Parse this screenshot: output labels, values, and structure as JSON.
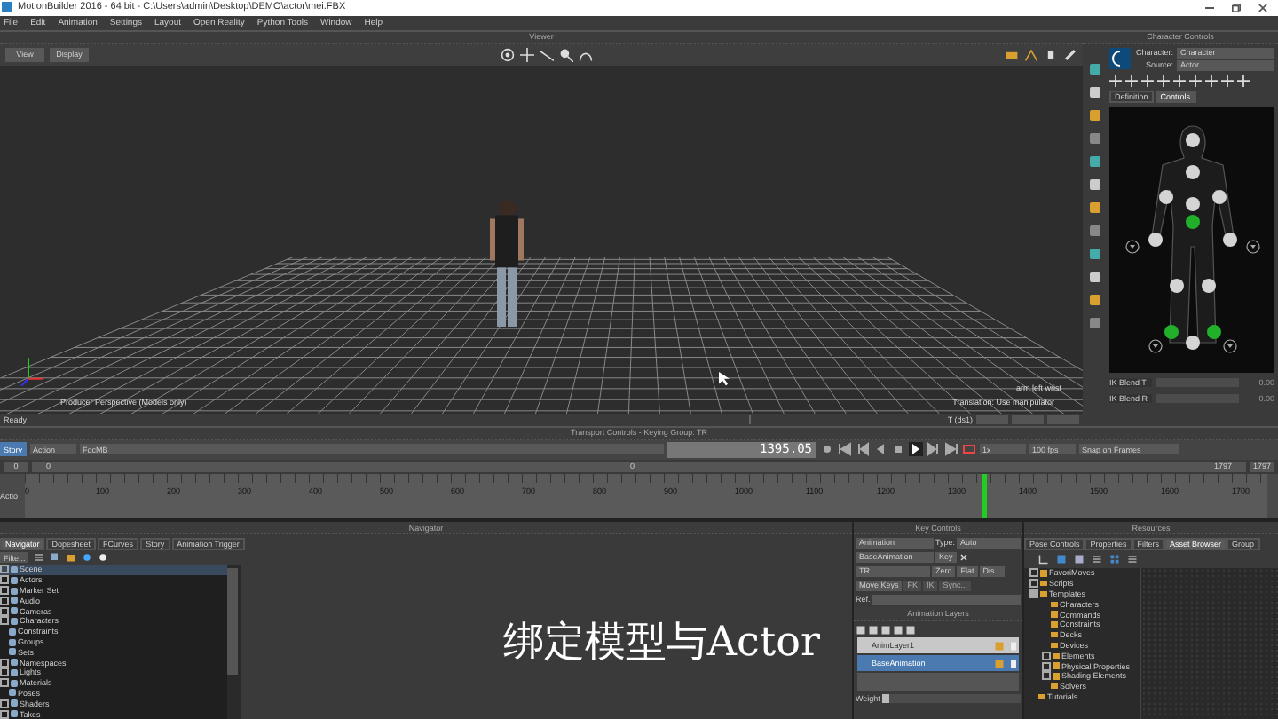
{
  "window": {
    "title": "MotionBuilder 2016  -  64 bit  -  C:\\Users\\admin\\Desktop\\DEMO\\actor\\mei.FBX"
  },
  "menu": [
    "File",
    "Edit",
    "Animation",
    "Settings",
    "Layout",
    "Open Reality",
    "Python Tools",
    "Window",
    "Help"
  ],
  "viewer": {
    "title": "Viewer",
    "buttons": [
      "View",
      "Display"
    ],
    "camera_label": "Producer Perspective (Models only)",
    "selection_label": "arm left wrist",
    "manipulator_label": "Translation: Use manipulator"
  },
  "status_bar": {
    "text": "Ready",
    "field_label": "T (ds1)"
  },
  "character_controls": {
    "title": "Character Controls",
    "character_label": "Character:",
    "character_value": "Character",
    "source_label": "Source:",
    "source_value": "Actor",
    "tabs": [
      {
        "label": "Definition",
        "selected": false
      },
      {
        "label": "Controls",
        "selected": true
      }
    ],
    "effectors": [
      {
        "color": "#d4d4d4"
      },
      {
        "color": "#d4d4d4"
      },
      {
        "color": "#d4d4d4"
      },
      {
        "color": "#d4d4d4"
      },
      {
        "color": "#d4d4d4"
      },
      {
        "color": "#22b02a"
      },
      {
        "color": "#d4d4d4"
      },
      {
        "color": "#d4d4d4"
      },
      {
        "color": "#d4d4d4"
      },
      {
        "color": "#d4d4d4"
      },
      {
        "color": "#22b02a"
      },
      {
        "color": "#22b02a"
      },
      {
        "color": "#d4d4d4"
      }
    ],
    "blend_rows": [
      {
        "label": "IK Blend T",
        "value": "0.00",
        "level": 0
      },
      {
        "label": "IK Blend R",
        "value": "0.00",
        "level": 0
      }
    ]
  },
  "transport": {
    "title": "Transport Controls  -  Keying Group: TR",
    "mode_tab": "Story",
    "mode_dropdown": "Action",
    "take": "FocMB",
    "timecode": "1395.05",
    "speed": "1x",
    "fps": "100 fps",
    "snap": "Snap on Frames",
    "start": "0",
    "zoom_start": "0",
    "zoom_mid": "0",
    "zoom_end": "1797",
    "end": "1797",
    "ruler_label": "Actio",
    "ticks": [
      "0",
      "100",
      "200",
      "300",
      "400",
      "500",
      "600",
      "700",
      "800",
      "900",
      "1000",
      "1100",
      "1200",
      "1300",
      "1400",
      "1500",
      "1600",
      "1700"
    ],
    "playhead": {
      "level": 0.77
    }
  },
  "navigator": {
    "title": "Navigator",
    "tabs": [
      {
        "label": "Navigator",
        "selected": true
      },
      {
        "label": "Dopesheet",
        "selected": false
      },
      {
        "label": "FCurves",
        "selected": false
      },
      {
        "label": "Story",
        "selected": false
      },
      {
        "label": "Animation Trigger",
        "selected": false
      }
    ],
    "filter": "Filte...",
    "tree": [
      {
        "label": "Scene",
        "expandable": true,
        "selected": true
      },
      {
        "label": "Actors",
        "expandable": true,
        "selected": false
      },
      {
        "label": "Marker Set",
        "expandable": true,
        "selected": false
      },
      {
        "label": "Audio",
        "expandable": true,
        "selected": false
      },
      {
        "label": "Cameras",
        "expandable": true,
        "selected": false
      },
      {
        "label": "Characters",
        "expandable": true,
        "selected": false
      },
      {
        "label": "Constraints",
        "expandable": false,
        "selected": false
      },
      {
        "label": "Groups",
        "expandable": false,
        "selected": false
      },
      {
        "label": "Sets",
        "expandable": false,
        "selected": false
      },
      {
        "label": "Namespaces",
        "expandable": true,
        "selected": false
      },
      {
        "label": "Lights",
        "expandable": true,
        "selected": false
      },
      {
        "label": "Materials",
        "expandable": true,
        "selected": false
      },
      {
        "label": "Poses",
        "expandable": false,
        "selected": false
      },
      {
        "label": "Shaders",
        "expandable": true,
        "selected": false
      },
      {
        "label": "Takes",
        "expandable": true,
        "selected": false
      }
    ]
  },
  "caption": "绑定模型与Actor",
  "key_controls": {
    "title": "Key Controls",
    "mode": "Animation",
    "type_label": "Type:",
    "type_value": "Auto",
    "layer": "BaseAnimation",
    "key_button": "Key",
    "group": "TR",
    "buttons": [
      "Zero",
      "Flat",
      "Dis..."
    ],
    "move_keys": "Move Keys",
    "disabled_buttons": [
      "FK",
      "IK",
      "Sync..."
    ],
    "ref_label": "Ref."
  },
  "animation_layers": {
    "title": "Animation Layers",
    "layers": [
      {
        "name": "AnimLayer1",
        "selected": false
      },
      {
        "name": "BaseAnimation",
        "selected": true
      }
    ],
    "weight_label": "Weight",
    "weight": {
      "level": 0.05
    }
  },
  "resources": {
    "title": "Resources",
    "tabs": [
      {
        "label": "Pose Controls",
        "selected": false
      },
      {
        "label": "Properties",
        "selected": false
      },
      {
        "label": "Filters",
        "selected": false
      },
      {
        "label": "Asset Browser",
        "selected": true
      },
      {
        "label": "Group",
        "selected": false
      }
    ],
    "tree": [
      {
        "label": "FavoriMoves",
        "expandable": true,
        "expanded": false
      },
      {
        "label": "Scripts",
        "expandable": true,
        "expanded": false
      },
      {
        "label": "Templates",
        "expandable": true,
        "expanded": true,
        "children": [
          {
            "label": "Characters",
            "expandable": false
          },
          {
            "label": "Commands",
            "expandable": false
          },
          {
            "label": "Constraints",
            "expandable": false
          },
          {
            "label": "Decks",
            "expandable": false
          },
          {
            "label": "Devices",
            "expandable": false
          },
          {
            "label": "Elements",
            "expandable": true,
            "expanded": false
          },
          {
            "label": "Physical Properties",
            "expandable": true,
            "expanded": false
          },
          {
            "label": "Shading Elements",
            "expandable": true,
            "expanded": false
          },
          {
            "label": "Solvers",
            "expandable": false
          }
        ]
      },
      {
        "label": "Tutorials",
        "expandable": false
      }
    ]
  }
}
